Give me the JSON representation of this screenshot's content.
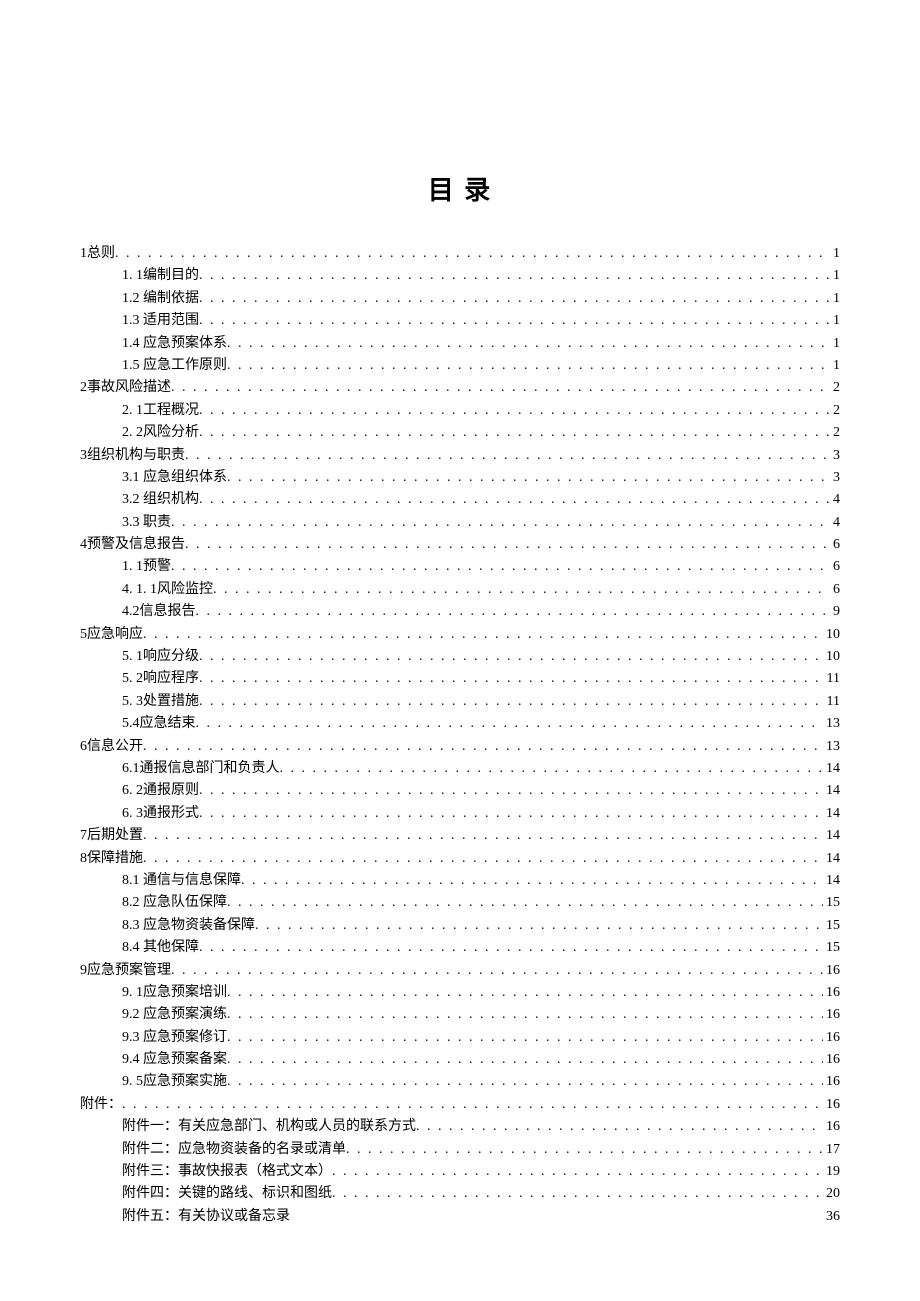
{
  "title": "目 录",
  "toc": [
    {
      "level": 1,
      "text": "1总则",
      "page": "1",
      "leader": true
    },
    {
      "level": 2,
      "text": "1. 1编制目的",
      "page": "1",
      "leader": true
    },
    {
      "level": 2,
      "text": "1.2  编制依据",
      "page": "1",
      "leader": true
    },
    {
      "level": 2,
      "text": "1.3  适用范围",
      "page": "1",
      "leader": true
    },
    {
      "level": 2,
      "text": "1.4  应急预案体系",
      "page": "1",
      "leader": true
    },
    {
      "level": 2,
      "text": "1.5  应急工作原则",
      "page": "1",
      "leader": true
    },
    {
      "level": 1,
      "text": "2事故风险描述",
      "page": "2",
      "leader": true
    },
    {
      "level": 2,
      "text": "2. 1工程概况",
      "page": "2",
      "leader": true
    },
    {
      "level": 2,
      "text": "2. 2风险分析",
      "page": "2",
      "leader": true
    },
    {
      "level": 1,
      "text": "3组织机构与职责",
      "page": "3",
      "leader": true
    },
    {
      "level": 2,
      "text": "3.1  应急组织体系",
      "page": "3",
      "leader": true
    },
    {
      "level": 2,
      "text": "3.2  组织机构",
      "page": "4",
      "leader": true
    },
    {
      "level": 2,
      "text": "3.3  职责",
      "page": "4",
      "leader": true
    },
    {
      "level": 1,
      "text": "4预警及信息报告",
      "page": "6",
      "leader": true
    },
    {
      "level": 2,
      "text": "1. 1预警",
      "page": "6",
      "leader": true
    },
    {
      "level": 2,
      "text": "4. 1. 1风险监控",
      "page": "6",
      "leader": true
    },
    {
      "level": 2,
      "text": "4.2信息报告",
      "page": "9",
      "leader": true
    },
    {
      "level": 1,
      "text": "5应急响应",
      "page": "10",
      "leader": true
    },
    {
      "level": 2,
      "text": "5. 1响应分级",
      "page": "10",
      "leader": true
    },
    {
      "level": 2,
      "text": "5. 2响应程序",
      "page": "11",
      "leader": true
    },
    {
      "level": 2,
      "text": "5. 3处置措施",
      "page": "11",
      "leader": true
    },
    {
      "level": 2,
      "text": "5.4应急结束",
      "page": "13",
      "leader": true
    },
    {
      "level": 1,
      "text": "6信息公开",
      "page": "13",
      "leader": true
    },
    {
      "level": 2,
      "text": "6.1通报信息部门和负责人",
      "page": "14",
      "leader": true
    },
    {
      "level": 2,
      "text": "6. 2通报原则",
      "page": "14",
      "leader": true
    },
    {
      "level": 2,
      "text": "6. 3通报形式",
      "page": "14",
      "leader": true
    },
    {
      "level": 1,
      "text": "7后期处置",
      "page": "14",
      "leader": true
    },
    {
      "level": 1,
      "text": "8保障措施",
      "page": "14",
      "leader": true
    },
    {
      "level": 2,
      "text": "8.1  通信与信息保障",
      "page": "14",
      "leader": true
    },
    {
      "level": 2,
      "text": "8.2  应急队伍保障",
      "page": "15",
      "leader": true
    },
    {
      "level": 2,
      "text": "8.3  应急物资装备保障",
      "page": "15",
      "leader": true
    },
    {
      "level": 2,
      "text": "8.4  其他保障",
      "page": "15",
      "leader": true
    },
    {
      "level": 1,
      "text": "9应急预案管理",
      "page": "16",
      "leader": true
    },
    {
      "level": 2,
      "text": "9. 1应急预案培训",
      "page": "16",
      "leader": true
    },
    {
      "level": 2,
      "text": "9.2  应急预案演练",
      "page": "16",
      "leader": true
    },
    {
      "level": 2,
      "text": "9.3  应急预案修订",
      "page": "16",
      "leader": true
    },
    {
      "level": 2,
      "text": "9.4  应急预案备案",
      "page": "16",
      "leader": true
    },
    {
      "level": 2,
      "text": "9. 5应急预案实施",
      "page": "16",
      "leader": true
    },
    {
      "level": 1,
      "text": "附件：",
      "page": "16",
      "leader": true
    },
    {
      "level": 2,
      "text": "附件一：有关应急部门、机构或人员的联系方式  ",
      "page": "16",
      "leader": true
    },
    {
      "level": 2,
      "text": "附件二：应急物资装备的名录或清单  ",
      "page": "17",
      "leader": true
    },
    {
      "level": 2,
      "text": "附件三：事故快报表（格式文本）  ",
      "page": "19",
      "leader": true
    },
    {
      "level": 2,
      "text": "附件四：关键的路线、标识和图纸  ",
      "page": "20",
      "leader": true
    },
    {
      "level": 2,
      "text": "附件五：有关协议或备忘录",
      "page": "36",
      "leader": false
    }
  ]
}
